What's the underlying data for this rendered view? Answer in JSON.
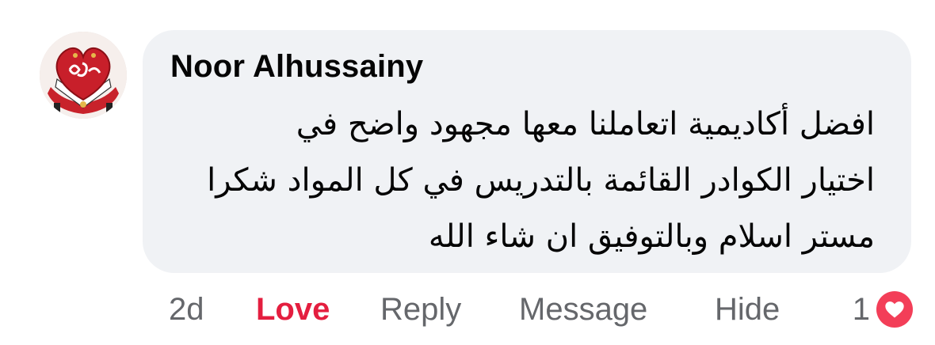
{
  "comment": {
    "author": "Noor Alhussainy",
    "lines": [
      "افضل أكاديمية اتعاملنا معها مجهود واضح في",
      "اختيار الكوادر القائمة بالتدريس في كل المواد شكرا",
      "مستر اسلام وبالتوفيق ان شاء الله"
    ],
    "avatar_icon": "heart-logo-avatar-icon"
  },
  "actions": {
    "time": "2d",
    "love": "Love",
    "reply": "Reply",
    "message": "Message",
    "hide": "Hide"
  },
  "reactions": {
    "count": "1",
    "icon": "heart-icon"
  },
  "colors": {
    "bubble_bg": "#f0f2f5",
    "love_active": "#e41e3f",
    "reaction_heart": "#f33e58",
    "secondary_text": "#65676b"
  }
}
